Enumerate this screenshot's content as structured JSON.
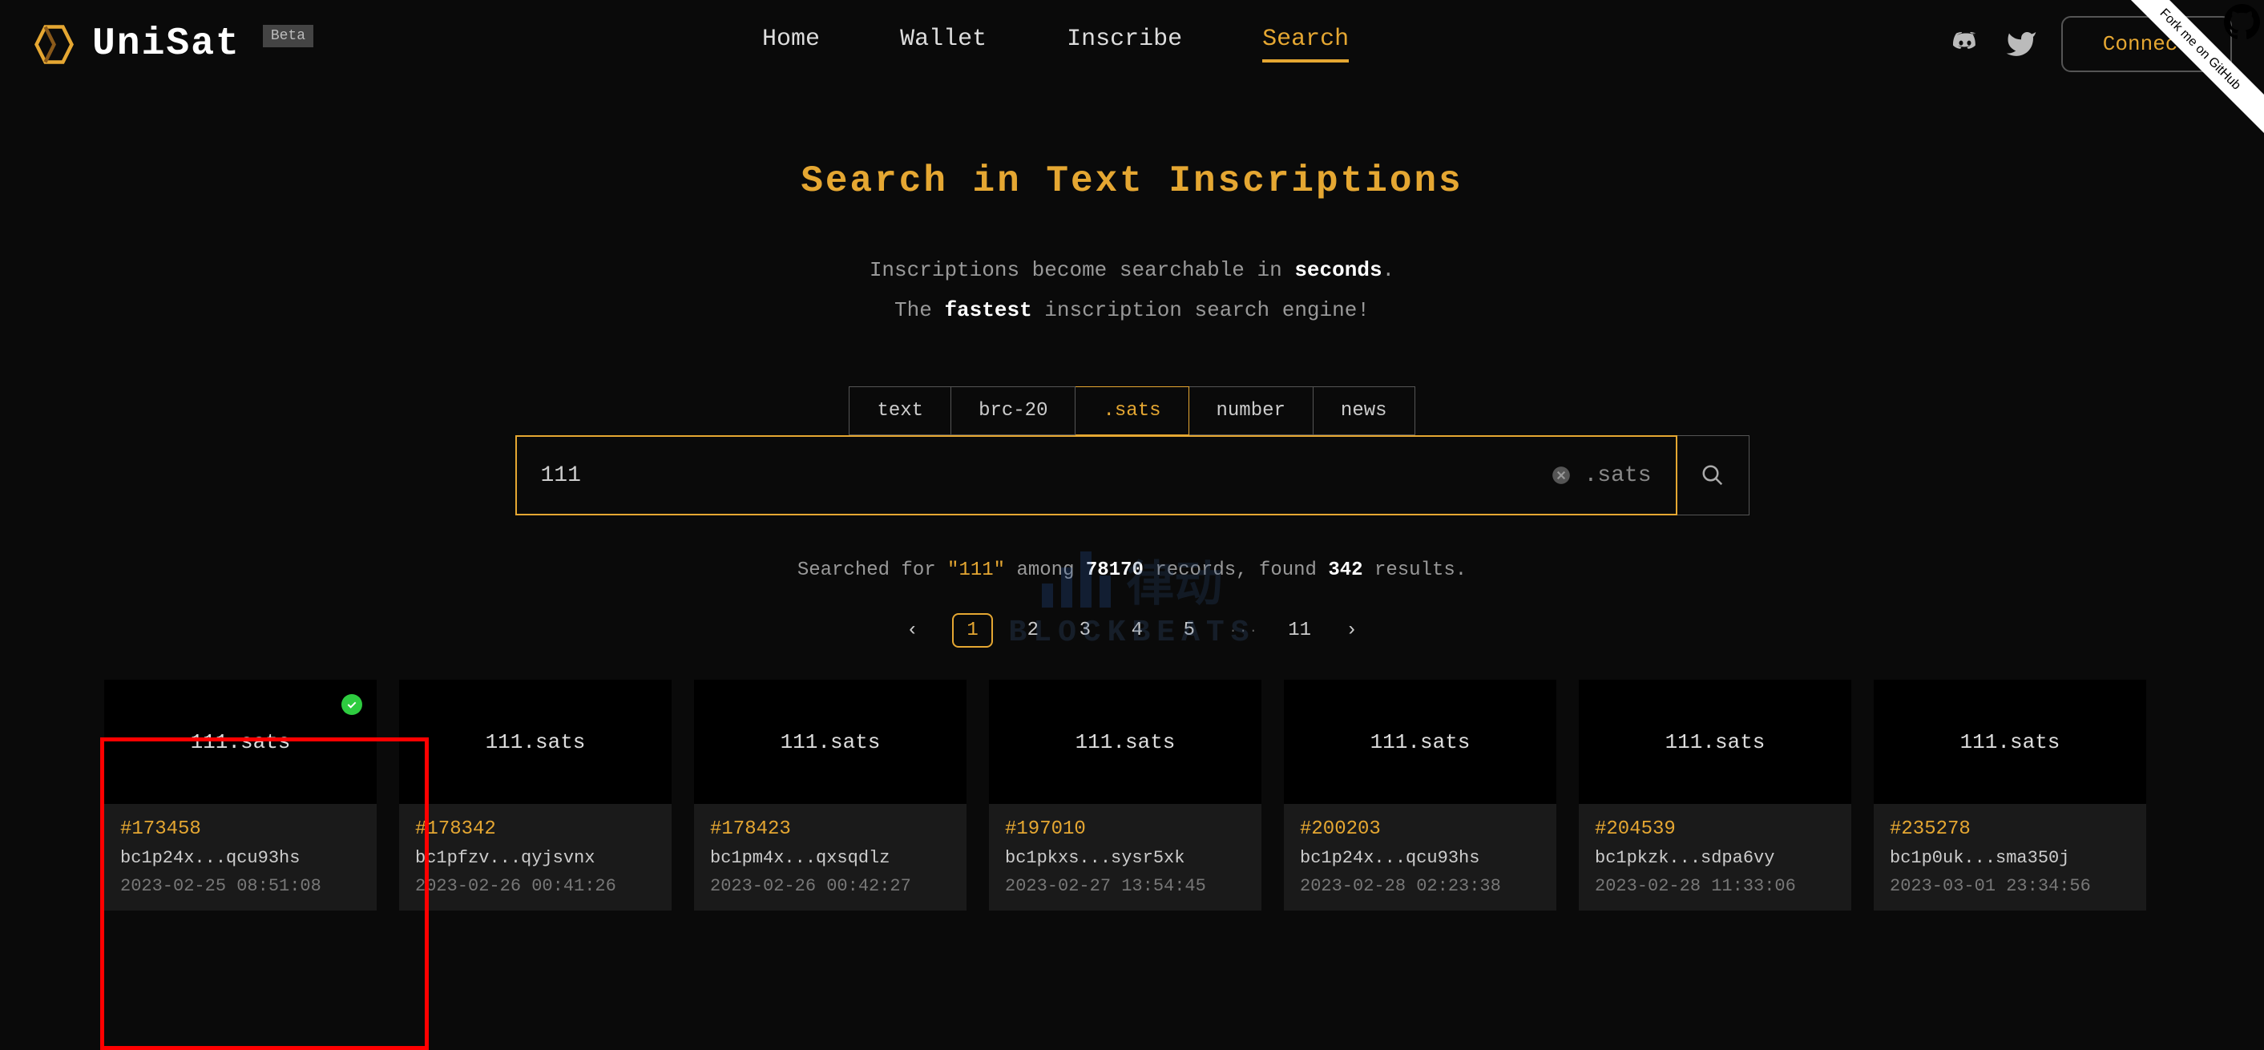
{
  "brand": {
    "name": "UniSat",
    "badge": "Beta"
  },
  "nav": {
    "items": [
      "Home",
      "Wallet",
      "Inscribe",
      "Search"
    ],
    "active": "Search"
  },
  "header": {
    "connect": "Connect",
    "github_ribbon": "Fork me on GitHub"
  },
  "page": {
    "title": "Search in Text Inscriptions",
    "subtitle_1_pre": "Inscriptions become searchable in ",
    "subtitle_1_strong": "seconds",
    "subtitle_1_post": ".",
    "subtitle_2_pre": "The ",
    "subtitle_2_strong": "fastest",
    "subtitle_2_post": " inscription search engine!"
  },
  "search": {
    "tabs": [
      "text",
      "brc-20",
      ".sats",
      "number",
      "news"
    ],
    "active_tab": ".sats",
    "value": "111",
    "suffix": ".sats"
  },
  "summary": {
    "pre": "Searched for ",
    "query": "\"111\"",
    "mid1": " among ",
    "total": "78170",
    "mid2": " records, found ",
    "found": "342",
    "post": " results."
  },
  "pagination": {
    "pages": [
      "1",
      "2",
      "3",
      "4",
      "5",
      "···",
      "11"
    ],
    "current": "1"
  },
  "results": [
    {
      "name": "111.sats",
      "id": "#173458",
      "addr": "bc1p24x...qcu93hs",
      "date": "2023-02-25 08:51:08",
      "verified": true
    },
    {
      "name": "111.sats",
      "id": "#178342",
      "addr": "bc1pfzv...qyjsvnx",
      "date": "2023-02-26 00:41:26",
      "verified": false
    },
    {
      "name": "111.sats",
      "id": "#178423",
      "addr": "bc1pm4x...qxsqdlz",
      "date": "2023-02-26 00:42:27",
      "verified": false
    },
    {
      "name": "111.sats",
      "id": "#197010",
      "addr": "bc1pkxs...sysr5xk",
      "date": "2023-02-27 13:54:45",
      "verified": false
    },
    {
      "name": "111.sats",
      "id": "#200203",
      "addr": "bc1p24x...qcu93hs",
      "date": "2023-02-28 02:23:38",
      "verified": false
    },
    {
      "name": "111.sats",
      "id": "#204539",
      "addr": "bc1pkzk...sdpa6vy",
      "date": "2023-02-28 11:33:06",
      "verified": false
    },
    {
      "name": "111.sats",
      "id": "#235278",
      "addr": "bc1p0uk...sma350j",
      "date": "2023-03-01 23:34:56",
      "verified": false
    }
  ],
  "watermark": {
    "cn": "律动",
    "en": "BLOCKBEATS"
  }
}
